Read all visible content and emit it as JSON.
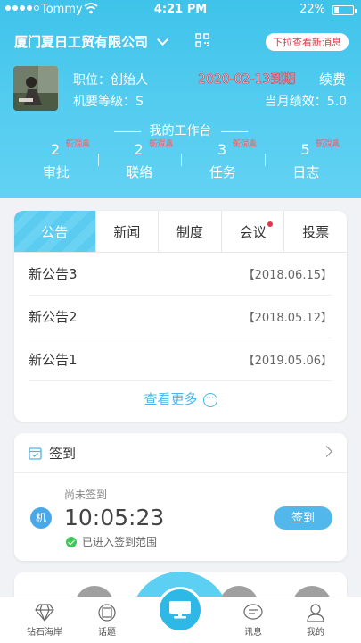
{
  "status_bar": {
    "carrier": "Tommy",
    "time": "4:21 PM",
    "battery": "22%",
    "battery_level": 0.22
  },
  "header": {
    "company": "厦门夏日工贸有限公司",
    "pull_tip": "下拉查看新消息",
    "position": "职位：创始人",
    "level": "机要等级：S",
    "expiry_date": "2020-02-13到期",
    "renew": "续费",
    "performance": "当月绩效：5.0"
  },
  "workbench": {
    "title": "我的工作台",
    "stats": [
      {
        "count": "2",
        "badge": "新消息",
        "label": "审批"
      },
      {
        "count": "2",
        "badge": "新消息",
        "label": "联络"
      },
      {
        "count": "3",
        "badge": "新消息",
        "label": "任务"
      },
      {
        "count": "5",
        "badge": "新消息",
        "label": "日志"
      }
    ]
  },
  "news": {
    "tabs": [
      "公告",
      "新闻",
      "制度",
      "会议",
      "投票"
    ],
    "active_tab": "公告",
    "items": [
      {
        "title": "新公告3",
        "date": "【2018.06.15】"
      },
      {
        "title": "新公告2",
        "date": "【2018.05.12】"
      },
      {
        "title": "新公告1",
        "date": "【2019.05.06】"
      }
    ],
    "more": "查看更多"
  },
  "checkin": {
    "title": "签到",
    "machine_badge": "机",
    "status": "尚未签到",
    "time": "10:05:23",
    "range": "已进入签到范围",
    "button": "签到"
  },
  "tabbar": {
    "items": [
      "钻石海岸",
      "话题",
      "讯息",
      "我的"
    ]
  },
  "colors": {
    "primary": "#4fc9ef",
    "accent_red": "#e0384a",
    "button_blue": "#52b8ec"
  }
}
